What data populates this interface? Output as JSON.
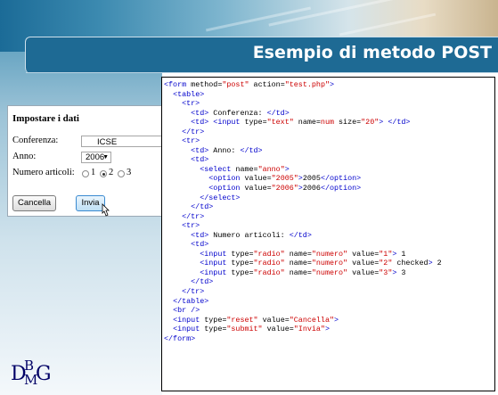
{
  "slide": {
    "title": "Esempio di metodo POST"
  },
  "form_preview": {
    "heading": "Impostare i dati",
    "conference_label": "Conferenza:",
    "conference_value": "ICSE",
    "year_label": "Anno:",
    "year_selected": "2006",
    "articles_label": "Numero articoli:",
    "radio_options": [
      "1",
      "2",
      "3"
    ],
    "radio_checked": "2",
    "reset_label": "Cancella",
    "submit_label": "Invia"
  },
  "code_lines": [
    [
      [
        "tag",
        "<form"
      ],
      [
        "attr",
        " method="
      ],
      [
        "val",
        "\"post\""
      ],
      [
        "attr",
        " action="
      ],
      [
        "val",
        "\"test.php\""
      ],
      [
        "tag",
        ">"
      ]
    ],
    [
      [
        "text",
        "  "
      ],
      [
        "tag",
        "<table>"
      ]
    ],
    [
      [
        "text",
        "    "
      ],
      [
        "tag",
        "<tr>"
      ]
    ],
    [
      [
        "text",
        "      "
      ],
      [
        "tag",
        "<td>"
      ],
      [
        "text",
        " Conferenza: "
      ],
      [
        "tag",
        "</td>"
      ]
    ],
    [
      [
        "text",
        "      "
      ],
      [
        "tag",
        "<td>"
      ],
      [
        "text",
        " "
      ],
      [
        "tag",
        "<input"
      ],
      [
        "attr",
        " type="
      ],
      [
        "val",
        "\"text\""
      ],
      [
        "attr",
        " name="
      ],
      [
        "val",
        "num"
      ],
      [
        "attr",
        " size="
      ],
      [
        "val",
        "\"20\""
      ],
      [
        "tag",
        ">"
      ],
      [
        "text",
        " "
      ],
      [
        "tag",
        "</td>"
      ]
    ],
    [
      [
        "text",
        "    "
      ],
      [
        "tag",
        "</tr>"
      ]
    ],
    [
      [
        "text",
        "    "
      ],
      [
        "tag",
        "<tr>"
      ]
    ],
    [
      [
        "text",
        "      "
      ],
      [
        "tag",
        "<td>"
      ],
      [
        "text",
        " Anno: "
      ],
      [
        "tag",
        "</td>"
      ]
    ],
    [
      [
        "text",
        "      "
      ],
      [
        "tag",
        "<td>"
      ]
    ],
    [
      [
        "text",
        "        "
      ],
      [
        "tag",
        "<select"
      ],
      [
        "attr",
        " name="
      ],
      [
        "val",
        "\"anno\""
      ],
      [
        "tag",
        ">"
      ]
    ],
    [
      [
        "text",
        "          "
      ],
      [
        "tag",
        "<option"
      ],
      [
        "attr",
        " value="
      ],
      [
        "val",
        "\"2005\""
      ],
      [
        "tag",
        ">"
      ],
      [
        "text",
        "2005"
      ],
      [
        "tag",
        "</option>"
      ]
    ],
    [
      [
        "text",
        "          "
      ],
      [
        "tag",
        "<option"
      ],
      [
        "attr",
        " value="
      ],
      [
        "val",
        "\"2006\""
      ],
      [
        "tag",
        ">"
      ],
      [
        "text",
        "2006"
      ],
      [
        "tag",
        "</option>"
      ]
    ],
    [
      [
        "text",
        "        "
      ],
      [
        "tag",
        "</select>"
      ]
    ],
    [
      [
        "text",
        "      "
      ],
      [
        "tag",
        "</td>"
      ]
    ],
    [
      [
        "text",
        "    "
      ],
      [
        "tag",
        "</tr>"
      ]
    ],
    [
      [
        "text",
        "    "
      ],
      [
        "tag",
        "<tr>"
      ]
    ],
    [
      [
        "text",
        "      "
      ],
      [
        "tag",
        "<td>"
      ],
      [
        "text",
        " Numero articoli: "
      ],
      [
        "tag",
        "</td>"
      ]
    ],
    [
      [
        "text",
        "      "
      ],
      [
        "tag",
        "<td>"
      ]
    ],
    [
      [
        "text",
        "        "
      ],
      [
        "tag",
        "<input"
      ],
      [
        "attr",
        " type="
      ],
      [
        "val",
        "\"radio\""
      ],
      [
        "attr",
        " name="
      ],
      [
        "val",
        "\"numero\""
      ],
      [
        "attr",
        " value="
      ],
      [
        "val",
        "\"1\""
      ],
      [
        "tag",
        ">"
      ],
      [
        "text",
        " 1"
      ]
    ],
    [
      [
        "text",
        "        "
      ],
      [
        "tag",
        "<input"
      ],
      [
        "attr",
        " type="
      ],
      [
        "val",
        "\"radio\""
      ],
      [
        "attr",
        " name="
      ],
      [
        "val",
        "\"numero\""
      ],
      [
        "attr",
        " value="
      ],
      [
        "val",
        "\"2\""
      ],
      [
        "attr",
        " checked"
      ],
      [
        "tag",
        ">"
      ],
      [
        "text",
        " 2"
      ]
    ],
    [
      [
        "text",
        "        "
      ],
      [
        "tag",
        "<input"
      ],
      [
        "attr",
        " type="
      ],
      [
        "val",
        "\"radio\""
      ],
      [
        "attr",
        " name="
      ],
      [
        "val",
        "\"numero\""
      ],
      [
        "attr",
        " value="
      ],
      [
        "val",
        "\"3\""
      ],
      [
        "tag",
        ">"
      ],
      [
        "text",
        " 3"
      ]
    ],
    [
      [
        "text",
        "      "
      ],
      [
        "tag",
        "</td>"
      ]
    ],
    [
      [
        "text",
        "    "
      ],
      [
        "tag",
        "</tr>"
      ]
    ],
    [
      [
        "text",
        "  "
      ],
      [
        "tag",
        "</table>"
      ]
    ],
    [
      [
        "text",
        "  "
      ],
      [
        "tag",
        "<br />"
      ]
    ],
    [
      [
        "text",
        "  "
      ],
      [
        "tag",
        "<input"
      ],
      [
        "attr",
        " type="
      ],
      [
        "val",
        "\"reset\""
      ],
      [
        "attr",
        " value="
      ],
      [
        "val",
        "\"Cancella\""
      ],
      [
        "tag",
        ">"
      ]
    ],
    [
      [
        "text",
        "  "
      ],
      [
        "tag",
        "<input"
      ],
      [
        "attr",
        " type="
      ],
      [
        "val",
        "\"submit\""
      ],
      [
        "attr",
        " value="
      ],
      [
        "val",
        "\"Invia\""
      ],
      [
        "tag",
        ">"
      ]
    ],
    [
      [
        "tag",
        "</form>"
      ]
    ]
  ],
  "colors": {
    "title_bar": "#1e6a94",
    "code_tag": "#0000cc",
    "code_value": "#cc0000",
    "logo": "#000066"
  },
  "logo": {
    "d": "D",
    "b": "B",
    "m": "M",
    "g": "G"
  }
}
